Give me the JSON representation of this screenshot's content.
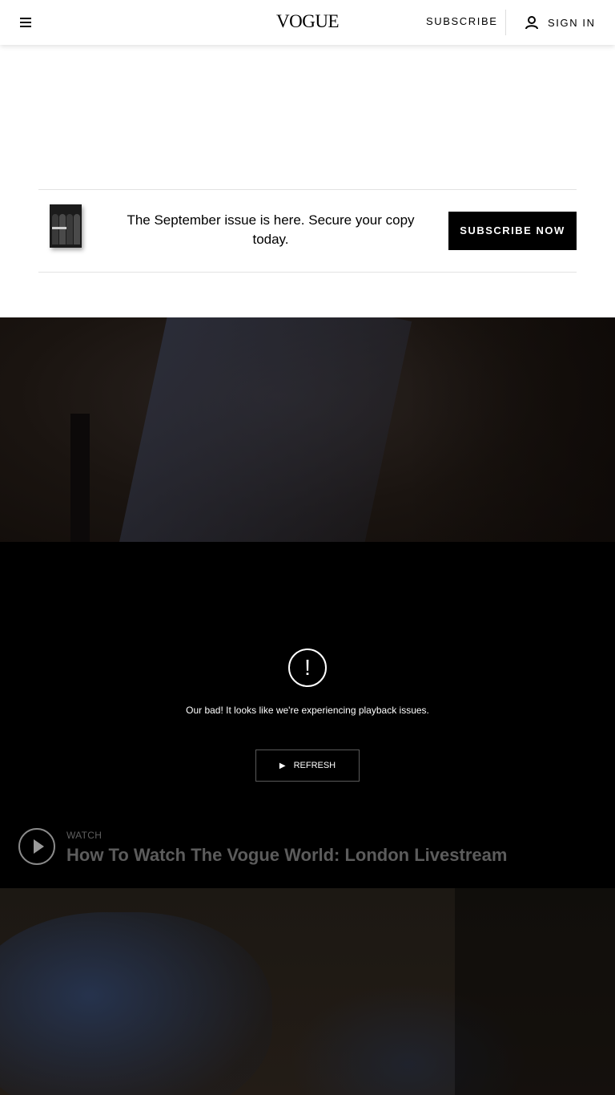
{
  "header": {
    "logo": "VOGUE",
    "subscribe_label": "SUBSCRIBE",
    "signin_label": "SIGN IN"
  },
  "promo": {
    "text": "The September issue is here. Secure your copy today.",
    "button_label": "SUBSCRIBE NOW"
  },
  "player": {
    "error_icon_glyph": "!",
    "error_message": "Our bad! It looks like we're experiencing playback issues.",
    "refresh_icon_glyph": "▶",
    "refresh_label": "REFRESH",
    "watch_label": "WATCH",
    "watch_title": "How To Watch The Vogue World: London Livestream"
  }
}
